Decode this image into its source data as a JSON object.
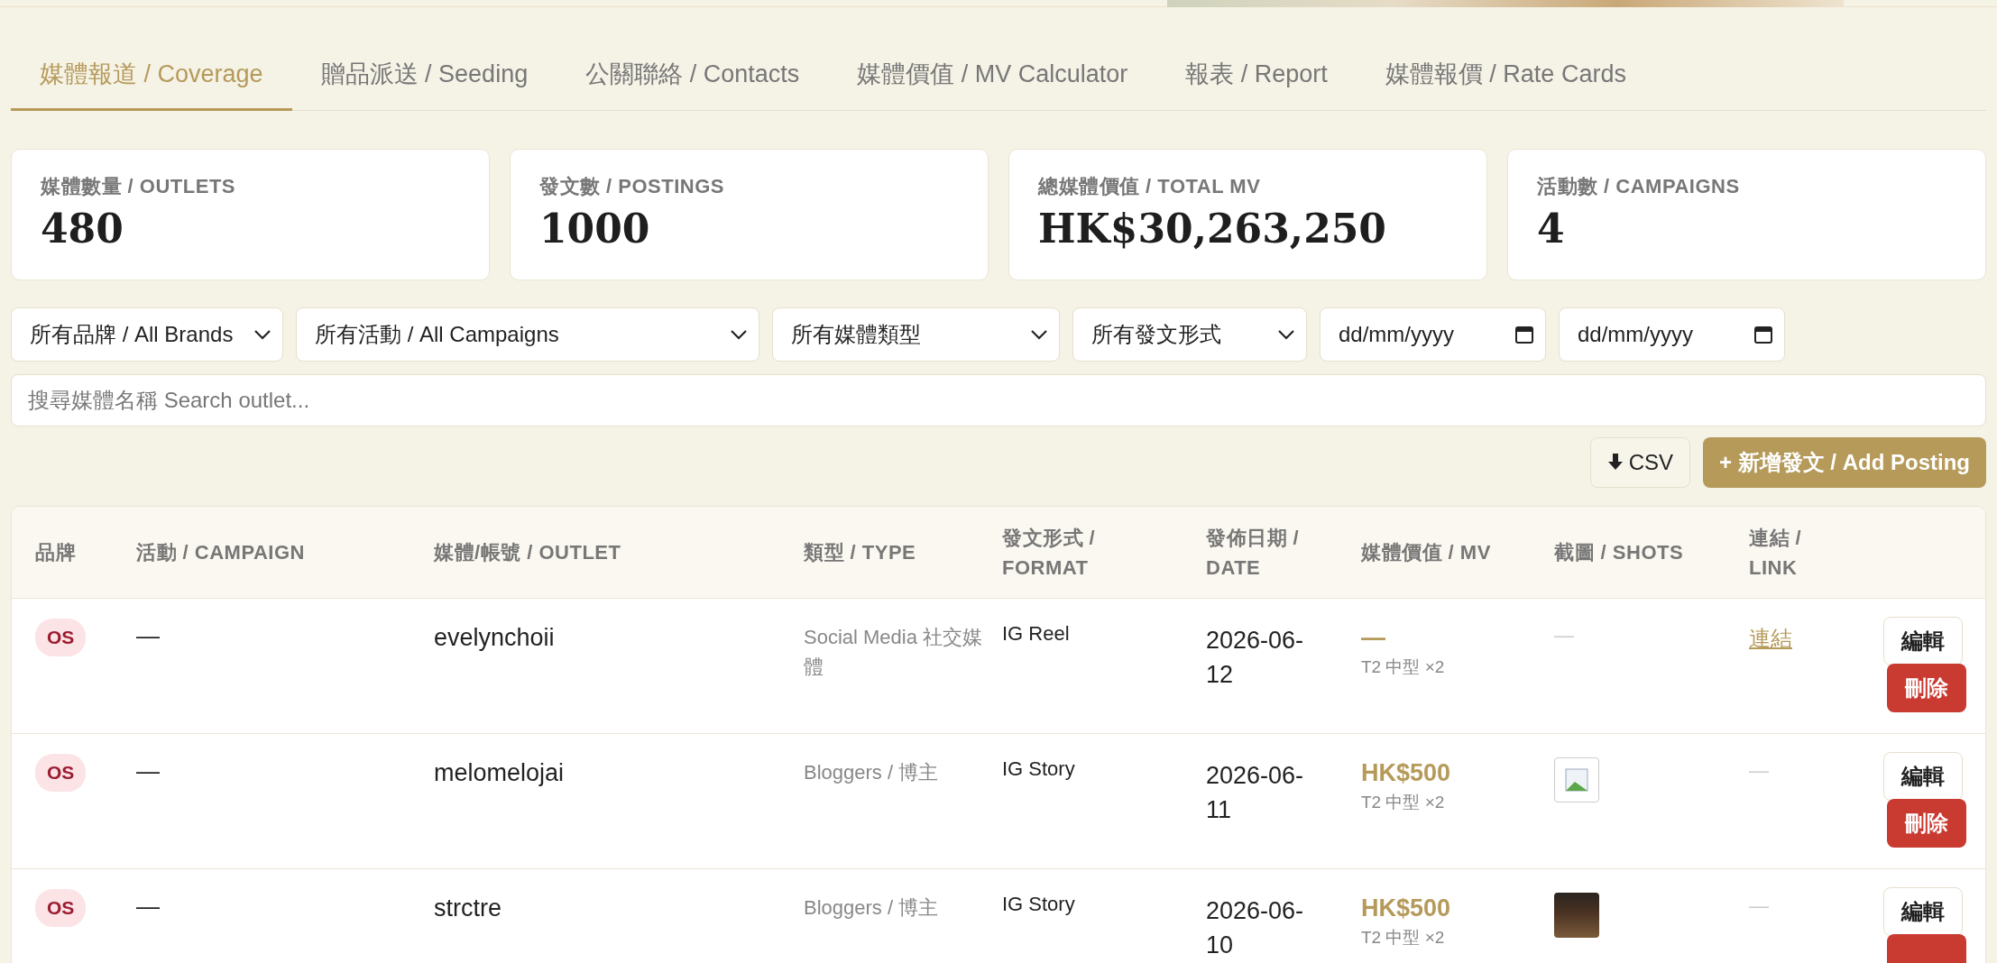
{
  "tabs": [
    {
      "label": "媒體報道 / Coverage",
      "selected": true
    },
    {
      "label": "贈品派送 / Seeding",
      "selected": false
    },
    {
      "label": "公關聯絡 / Contacts",
      "selected": false
    },
    {
      "label": "媒體價值 / MV Calculator",
      "selected": false
    },
    {
      "label": "報表 / Report",
      "selected": false
    },
    {
      "label": "媒體報價 / Rate Cards",
      "selected": false
    }
  ],
  "stats": [
    {
      "label": "媒體數量 / OUTLETS",
      "value": "480"
    },
    {
      "label": "發文數 / POSTINGS",
      "value": "1000"
    },
    {
      "label": "總媒體價值 / TOTAL MV",
      "value": "HK$30,263,250"
    },
    {
      "label": "活動數 / CAMPAIGNS",
      "value": "4"
    }
  ],
  "filters": [
    {
      "kind": "select",
      "value": "所有品牌 / All Brands"
    },
    {
      "kind": "select",
      "value": "所有活動 / All Campaigns"
    },
    {
      "kind": "select",
      "value": "所有媒體類型"
    },
    {
      "kind": "select",
      "value": "所有發文形式"
    },
    {
      "kind": "date",
      "placeholder": "dd/mm/yyyy"
    },
    {
      "kind": "date",
      "placeholder": "dd/mm/yyyy"
    }
  ],
  "search": {
    "placeholder": "搜尋媒體名稱 Search outlet..."
  },
  "actions": {
    "csv": "CSV",
    "add": "+ 新增發文 / Add Posting"
  },
  "table": {
    "columns": [
      "品牌",
      "活動 / CAMPAIGN",
      "媒體/帳號 / OUTLET",
      "類型 / TYPE",
      "發文形式 / FORMAT",
      "發佈日期 / DATE",
      "媒體價值 / MV",
      "截圖 / SHOTS",
      "連結 / LINK"
    ],
    "rows": [
      {
        "brand": "OS",
        "campaign": "—",
        "outlet": "evelynchoii",
        "type": "Social Media 社交媒體",
        "format": "IG Reel",
        "date": "2026-06-12",
        "mv": "—",
        "tier": "T2 中型 ×2",
        "shot": {
          "kind": "empty",
          "text": "—"
        },
        "link": "連結",
        "edit": "編輯",
        "delete": "刪除"
      },
      {
        "brand": "OS",
        "campaign": "—",
        "outlet": "melomelojai",
        "type": "Bloggers / 博主",
        "format": "IG Story",
        "date": "2026-06-11",
        "mv": "HK$500",
        "tier": "T2 中型 ×2",
        "shot": {
          "kind": "broken"
        },
        "link": "—",
        "edit": "編輯",
        "delete": "刪除"
      },
      {
        "brand": "OS",
        "campaign": "—",
        "outlet": "strctre",
        "type": "Bloggers / 博主",
        "format": "IG Story",
        "date": "2026-06-10",
        "mv": "HK$500",
        "tier": "T2 中型 ×2",
        "shot": {
          "kind": "photo"
        },
        "link": "—",
        "edit": "編輯"
      }
    ]
  }
}
